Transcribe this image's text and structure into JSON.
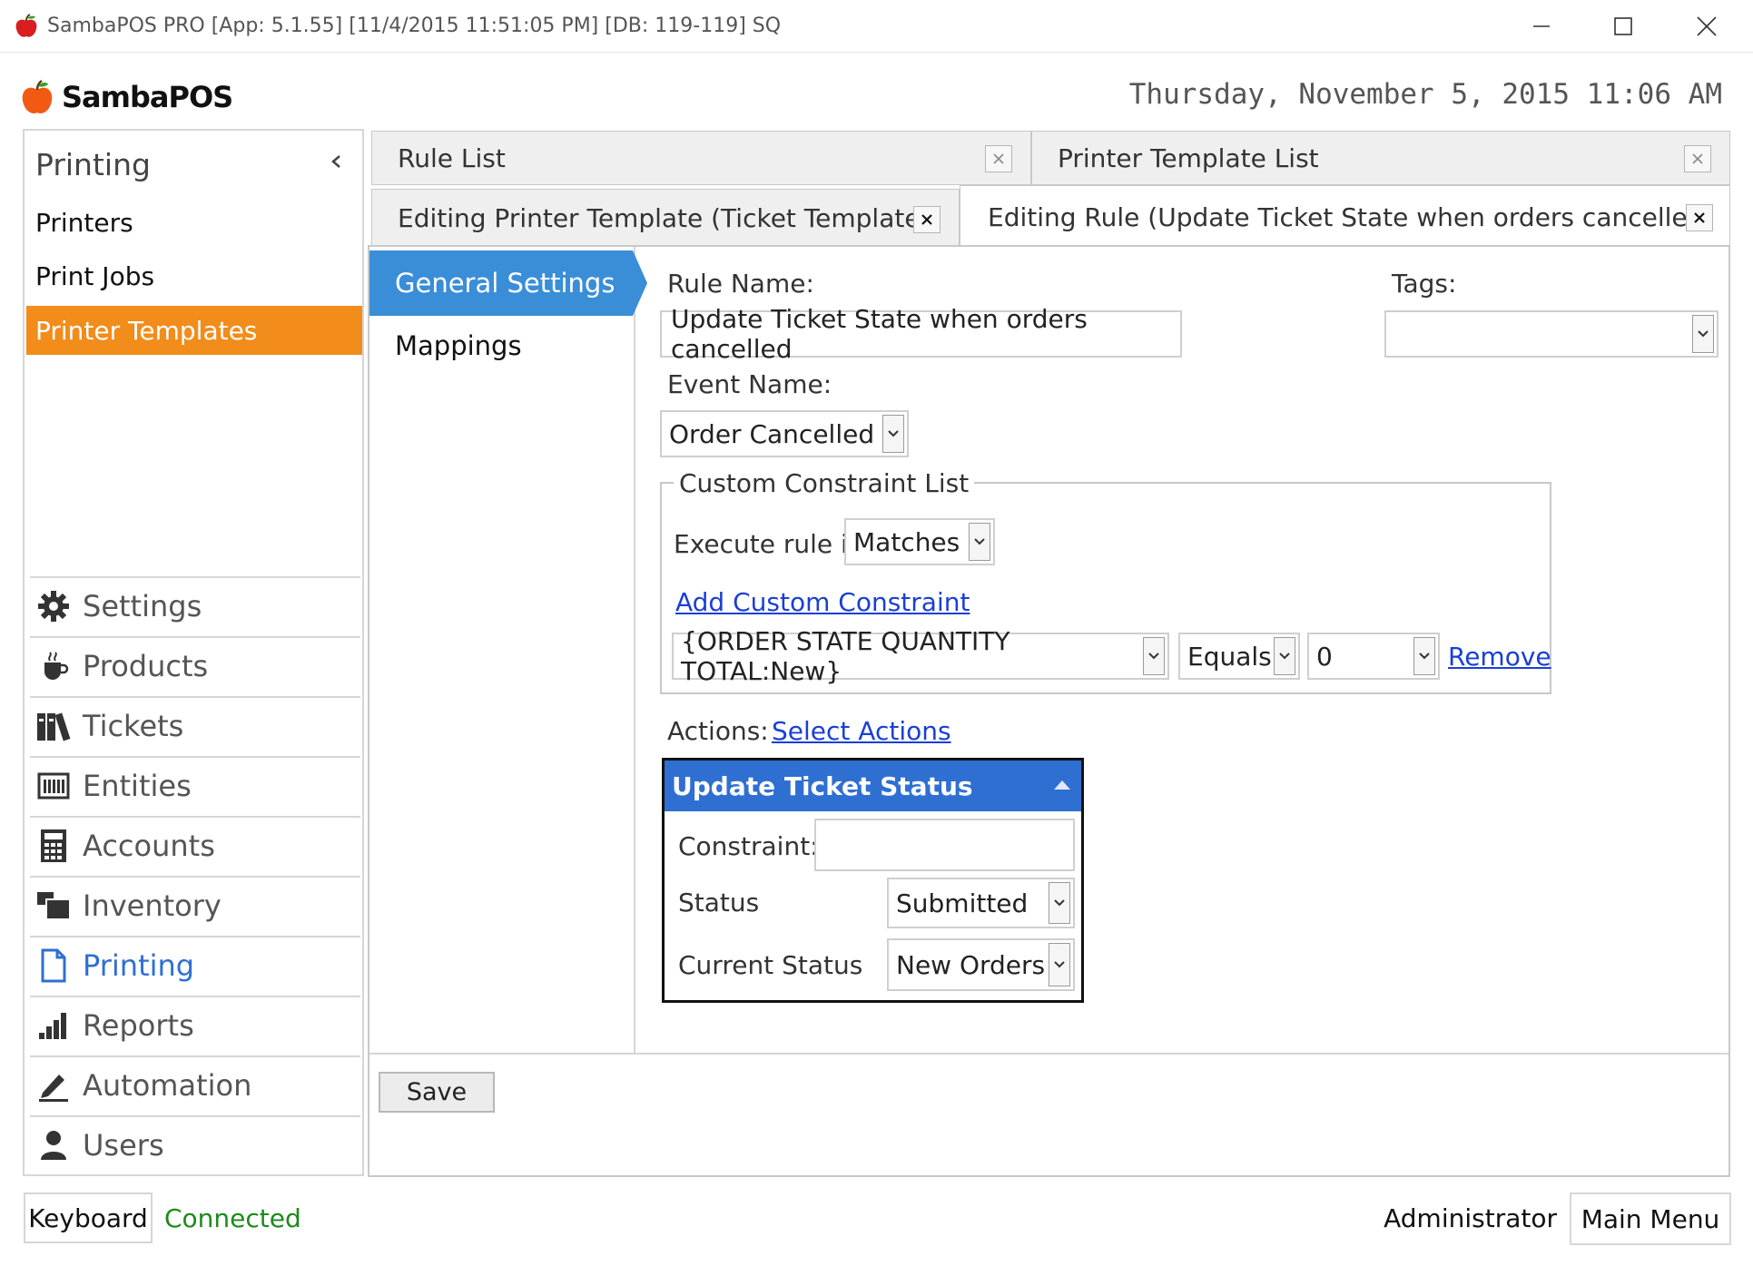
{
  "window": {
    "title": "SambaPOS PRO [App: 5.1.55] [11/4/2015 11:51:05 PM] [DB: 119-119] SQ"
  },
  "brand": {
    "name": "SambaPOS"
  },
  "clock": "Thursday, November 5, 2015 11:06 AM",
  "left_panel": {
    "header": "Printing",
    "items": [
      {
        "label": "Printers",
        "active": false
      },
      {
        "label": "Print Jobs",
        "active": false
      },
      {
        "label": "Printer Templates",
        "active": true
      }
    ],
    "modules": [
      {
        "label": "Settings",
        "icon": "gear-icon"
      },
      {
        "label": "Products",
        "icon": "coffee-cup-icon"
      },
      {
        "label": "Tickets",
        "icon": "books-icon"
      },
      {
        "label": "Entities",
        "icon": "table-icon"
      },
      {
        "label": "Accounts",
        "icon": "calculator-icon"
      },
      {
        "label": "Inventory",
        "icon": "inventory-icon"
      },
      {
        "label": "Printing",
        "icon": "document-icon",
        "active": true
      },
      {
        "label": "Reports",
        "icon": "bar-chart-icon"
      },
      {
        "label": "Automation",
        "icon": "pencil-icon"
      },
      {
        "label": "Users",
        "icon": "user-icon"
      }
    ]
  },
  "tabs": {
    "row1": [
      {
        "label": "Rule List"
      },
      {
        "label": "Printer Template List"
      }
    ],
    "row2": [
      {
        "label": "Editing Printer Template (Ticket Template)"
      },
      {
        "label": "Editing Rule (Update Ticket State when orders cancelled)",
        "active": true
      }
    ]
  },
  "nav": {
    "general_settings": "General Settings",
    "mappings": "Mappings"
  },
  "form": {
    "rule_name_label": "Rule Name:",
    "rule_name_value": "Update Ticket State when orders cancelled",
    "tags_label": "Tags:",
    "tags_value": "",
    "event_name_label": "Event Name:",
    "event_name_value": "Order Cancelled",
    "constraint_group_title": "Custom Constraint List",
    "execute_rule_label": "Execute rule if",
    "execute_rule_value": "Matches",
    "add_constraint_link": "Add Custom Constraint",
    "constraint_field": "{ORDER STATE QUANTITY TOTAL:New}",
    "constraint_operator": "Equals",
    "constraint_value": "0",
    "remove_link": "Remove",
    "actions_label": "Actions:",
    "select_actions_link": "Select Actions"
  },
  "action_card": {
    "title": "Update Ticket Status",
    "constraint_label": "Constraint:",
    "constraint_value": "",
    "status_label": "Status",
    "status_value": "Submitted",
    "current_status_label": "Current Status",
    "current_status_value": "New Orders"
  },
  "buttons": {
    "save": "Save"
  },
  "status_bar": {
    "keyboard": "Keyboard",
    "connection": "Connected",
    "user": "Administrator",
    "main_menu": "Main Menu"
  },
  "colors": {
    "accent_orange": "#f28c1a",
    "accent_blue": "#3a8ed8",
    "card_header_blue": "#2f6fd1",
    "link_blue": "#1a3fd6",
    "connected_green": "#1d8a1d"
  }
}
